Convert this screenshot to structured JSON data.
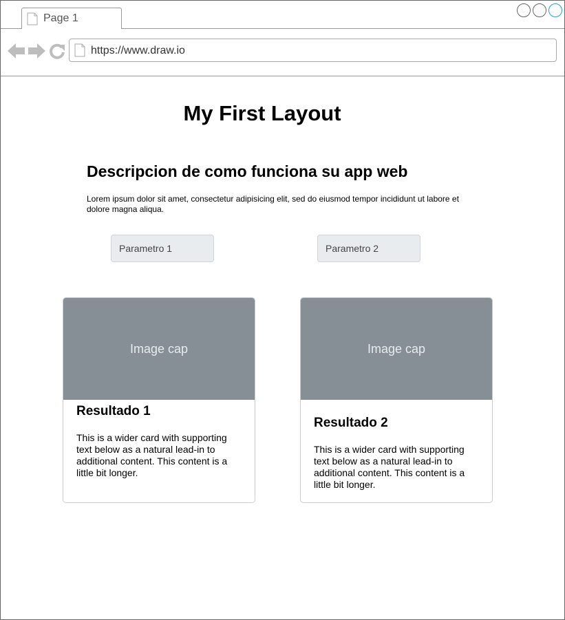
{
  "browser": {
    "tab": {
      "label": "Page 1",
      "icon": "document-icon"
    },
    "url": "https://www.draw.io",
    "nav_icons": [
      "back-arrow-icon",
      "forward-arrow-icon",
      "reload-icon"
    ],
    "accent_color": "#1ba1e2"
  },
  "page": {
    "title": "My First Layout",
    "subtitle": "Descripcion de como funciona su app web",
    "description": "Lorem ipsum dolor sit amet, consectetur adipisicing elit, sed do eiusmod tempor incididunt ut labore et dolore magna aliqua.",
    "params": [
      {
        "label": "Parametro 1"
      },
      {
        "label": "Parametro 2"
      }
    ],
    "cards": [
      {
        "image_label": "Image cap",
        "title": "Resultado 1",
        "text": "This is a wider card with supporting text below as a natural lead-in to additional content. This content is a little bit longer."
      },
      {
        "image_label": "Image cap",
        "title": "Resultado 2",
        "text": "This is a wider card with supporting text below as a natural lead-in to additional content. This content is a little bit longer."
      }
    ]
  }
}
